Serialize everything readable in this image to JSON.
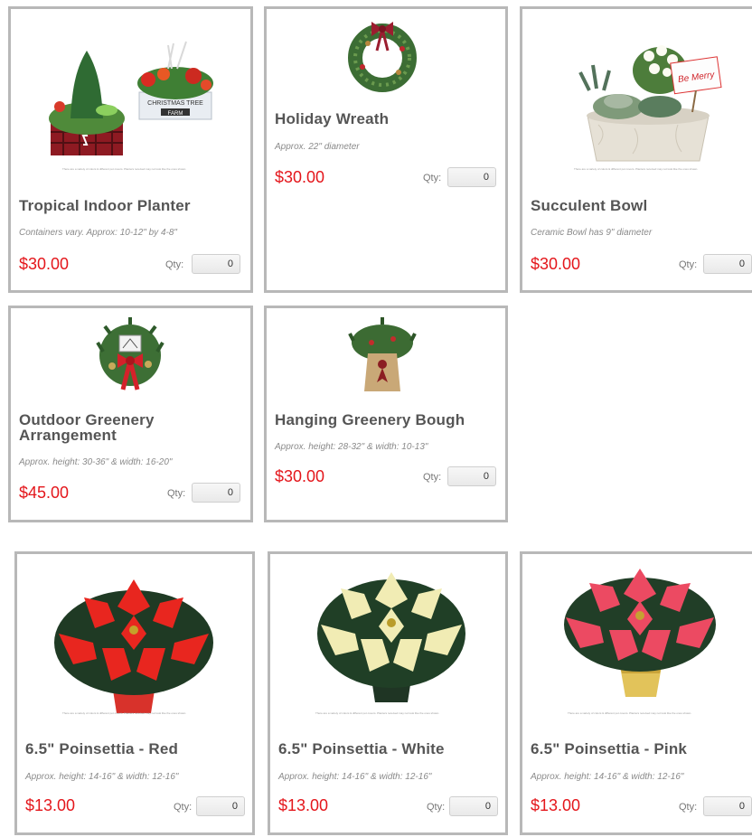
{
  "products": [
    {
      "title": "Tropical Indoor Planter",
      "desc": "Containers vary. Approx: 10-12\" by 4-8\"",
      "price": "$30.00",
      "qty_label": "Qty:",
      "qty_value": "0",
      "fine_print": "There are a variety of colors & different pot covers. Planters received may not look like the ones shown."
    },
    {
      "title": "Holiday Wreath",
      "desc": "Approx. 22\" diameter",
      "price": "$30.00",
      "qty_label": "Qty:",
      "qty_value": "0"
    },
    {
      "title": "Succulent Bowl",
      "desc": "Ceramic Bowl has 9\" diameter",
      "price": "$30.00",
      "qty_label": "Qty:",
      "qty_value": "0",
      "fine_print": "There are a variety of colors & different pot covers. Planters received may not look like the ones shown.",
      "sign_text": "Be Merry"
    },
    {
      "title": "Outdoor Greenery Arrangement",
      "desc": "Approx. height: 30-36\" & width: 16-20\"",
      "price": "$45.00",
      "qty_label": "Qty:",
      "qty_value": "0"
    },
    {
      "title": "Hanging Greenery Bough",
      "desc": "Approx. height: 28-32\" & width: 10-13\"",
      "price": "$30.00",
      "qty_label": "Qty:",
      "qty_value": "0"
    },
    {
      "title": "6.5\" Poinsettia - Red",
      "desc": "Approx. height: 14-16\" & width: 12-16\"",
      "price": "$13.00",
      "qty_label": "Qty:",
      "qty_value": "0",
      "fine_print": "There are a variety of colors & different pot covers. Planters received may not look like the ones shown.",
      "color": "#e8261f"
    },
    {
      "title": "6.5\" Poinsettia - White",
      "desc": "Approx. height: 14-16\" & width: 12-16\"",
      "price": "$13.00",
      "qty_label": "Qty:",
      "qty_value": "0",
      "fine_print": "There are a variety of colors & different pot covers. Planters received may not look like the ones shown.",
      "color": "#f1ecb4"
    },
    {
      "title": "6.5\" Poinsettia - Pink",
      "desc": "Approx. height: 14-16\" & width: 12-16\"",
      "price": "$13.00",
      "qty_label": "Qty:",
      "qty_value": "0",
      "fine_print": "There are a variety of colors & different pot covers. Planters received may not look like the ones shown.",
      "color": "#ec4a62"
    }
  ],
  "signage": {
    "christmas_tree_sign": "CHRISTMAS TREE",
    "farm_sign": "FARM"
  },
  "colors": {
    "price": "#e4161b",
    "border": "#b8b8b8",
    "title": "#555555"
  }
}
